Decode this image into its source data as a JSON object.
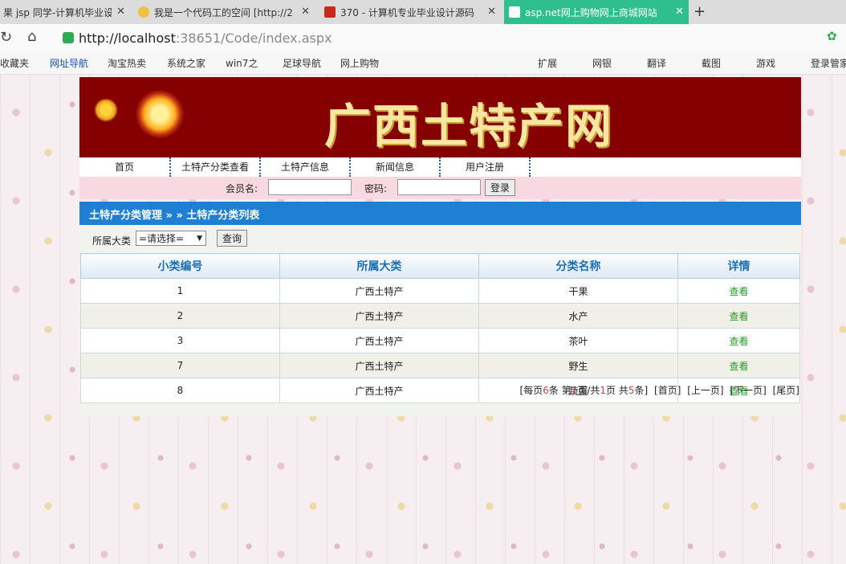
{
  "browser": {
    "tabs": [
      {
        "title": "果 jsp 同学-计算机毕业设",
        "color": "#ffffff"
      },
      {
        "title": "我是一个代码工的空间 [http://2",
        "color": "#f0c040"
      },
      {
        "title": "370 - 计算机专业毕业设计源码",
        "color": "#c8281e"
      },
      {
        "title": "asp.net网上购物网上商城网站",
        "color": "#ffffff"
      }
    ],
    "url_prefix": "http://localhost",
    "url_rest": ":38651/Code/index.aspx",
    "bookmarks": [
      "收藏夹",
      "网址导航",
      "淘宝热卖",
      "系统之家",
      "win7之",
      "足球导航",
      "网上购物"
    ],
    "extensions": [
      "扩展",
      "网银",
      "翻译",
      "截图",
      "游戏",
      "登录管家"
    ]
  },
  "site": {
    "banner_title": "广西土特产网",
    "nav": [
      "首页",
      "土特产分类查看",
      "土特产信息",
      "新闻信息",
      "用户注册"
    ],
    "login": {
      "user_label": "会员名:",
      "pass_label": "密码:",
      "button": "登录"
    },
    "section_title": "土特产分类管理 » » 土特产分类列表",
    "filter": {
      "label": "所属大类",
      "selected": "=请选择=",
      "button": "查询"
    },
    "table": {
      "headers": [
        "小类编号",
        "所属大类",
        "分类名称",
        "详情"
      ],
      "rows": [
        {
          "id": "1",
          "category": "广西土特产",
          "name": "干果",
          "detail": "查看"
        },
        {
          "id": "2",
          "category": "广西土特产",
          "name": "水产",
          "detail": "查看"
        },
        {
          "id": "3",
          "category": "广西土特产",
          "name": "茶叶",
          "detail": "查看"
        },
        {
          "id": "7",
          "category": "广西土特产",
          "name": "野生",
          "detail": "查看"
        },
        {
          "id": "8",
          "category": "广西土特产",
          "name": "蔬蛋",
          "detail": "查看"
        }
      ]
    },
    "pager": {
      "per_page_pre": "[每页",
      "per_page": "6",
      "per_page_post": "条 第",
      "page": "1",
      "page_post": "页/共",
      "total_pages": "1",
      "total_pages_post": "页 共",
      "total": "5",
      "total_post": "条]",
      "first": "[首页]",
      "prev": "[上一页]",
      "next": "[下一页]",
      "last": "[尾页]"
    }
  },
  "colors": {
    "banner": "#850000",
    "section": "#1f7fd2",
    "login_bar": "#f8d9e2",
    "active_tab": "#2fbf8f"
  }
}
